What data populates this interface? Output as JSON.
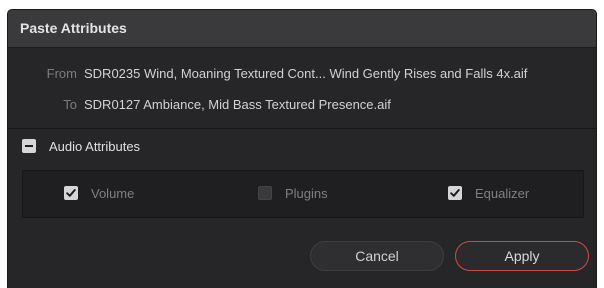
{
  "dialog": {
    "title": "Paste Attributes",
    "from": {
      "label": "From",
      "value": "SDR0235 Wind, Moaning Textured Cont... Wind Gently Rises and Falls 4x.aif"
    },
    "to": {
      "label": "To",
      "value": "SDR0127 Ambiance, Mid Bass Textured Presence.aif"
    },
    "section": {
      "title": "Audio Attributes",
      "expanded": true
    },
    "attributes": [
      {
        "label": "Volume",
        "checked": true
      },
      {
        "label": "Plugins",
        "checked": false
      },
      {
        "label": "Equalizer",
        "checked": true
      }
    ],
    "buttons": {
      "cancel": "Cancel",
      "apply": "Apply"
    },
    "colors": {
      "background": "#262628",
      "titlebar": "#3a3a3d",
      "accent": "#d8463f",
      "text": "#d2d2d4",
      "muted": "#7c7c80"
    }
  }
}
